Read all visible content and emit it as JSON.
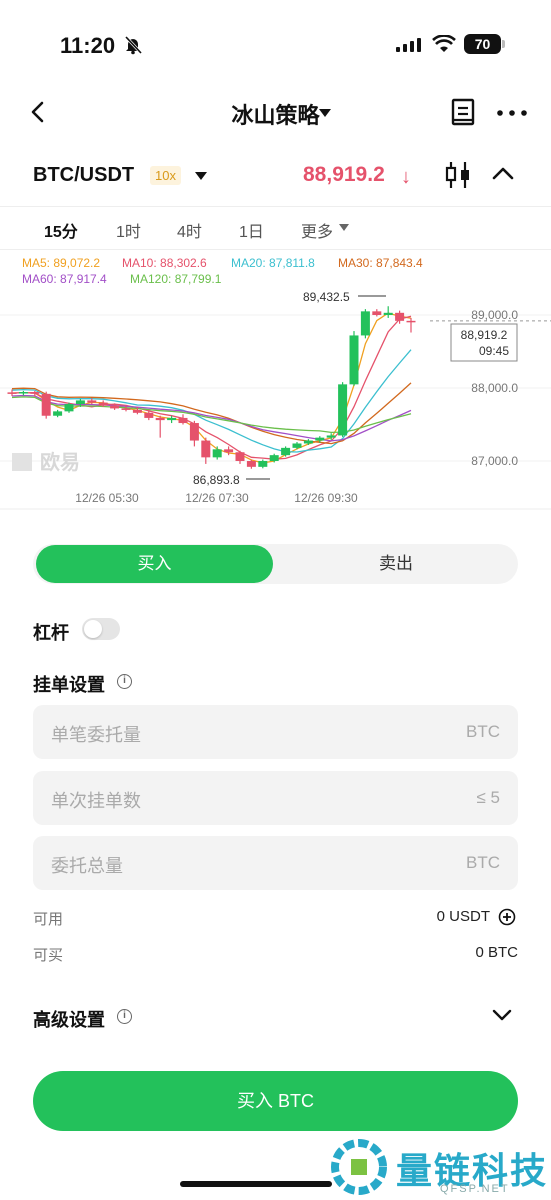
{
  "status": {
    "time": "11:20",
    "battery": "70"
  },
  "header": {
    "title": "冰山策略"
  },
  "market": {
    "pair": "BTC/USDT",
    "leverage": "10x",
    "price": "88,919.2",
    "price_arrow": "↓"
  },
  "timeframes": [
    "15分",
    "1时",
    "4时",
    "1日",
    "更多"
  ],
  "active_timeframe": 0,
  "ma_legend": {
    "ma5": "MA5: 89,072.2",
    "ma10": "MA10: 88,302.6",
    "ma20": "MA20: 87,811.8",
    "ma30": "MA30: 87,843.4",
    "ma60": "MA60: 87,917.4",
    "ma120": "MA120: 87,799.1"
  },
  "colors": {
    "up": "#23c15b",
    "down": "#e5526b",
    "ma5": "#f0a020",
    "ma10": "#e5526b",
    "ma20": "#3bbfcf",
    "ma30": "#d2691e",
    "ma60": "#a24fc7",
    "ma120": "#6abf4b"
  },
  "chart_data": {
    "type": "candlestick",
    "y_ticks": [
      "89,000.0",
      "88,000.0",
      "87,000.0"
    ],
    "x_ticks": [
      "12/26 05:30",
      "12/26 07:30",
      "12/26 09:30"
    ],
    "high_label": "89,432.5",
    "low_label": "86,893.8",
    "current_price_label": "88,919.2",
    "countdown": "09:45",
    "watermark": "欧易",
    "candles": [
      [
        87940,
        87980,
        87890,
        87930
      ],
      [
        87930,
        87960,
        87900,
        87945
      ],
      [
        87945,
        87960,
        87880,
        87920
      ],
      [
        87920,
        87950,
        87580,
        87620
      ],
      [
        87620,
        87700,
        87600,
        87680
      ],
      [
        87680,
        87800,
        87660,
        87780
      ],
      [
        87780,
        87850,
        87740,
        87830
      ],
      [
        87830,
        87860,
        87780,
        87800
      ],
      [
        87800,
        87830,
        87740,
        87760
      ],
      [
        87760,
        87790,
        87700,
        87720
      ],
      [
        87720,
        87760,
        87680,
        87700
      ],
      [
        87700,
        87740,
        87640,
        87660
      ],
      [
        87660,
        87700,
        87560,
        87590
      ],
      [
        87590,
        87620,
        87320,
        87560
      ],
      [
        87560,
        87620,
        87520,
        87590
      ],
      [
        87590,
        87640,
        87500,
        87520
      ],
      [
        87520,
        87550,
        87200,
        87280
      ],
      [
        87280,
        87320,
        86960,
        87050
      ],
      [
        87050,
        87200,
        87020,
        87160
      ],
      [
        87160,
        87200,
        87080,
        87120
      ],
      [
        87120,
        87140,
        86960,
        87000
      ],
      [
        87000,
        87020,
        86893.8,
        86920
      ],
      [
        86920,
        87020,
        86900,
        87000
      ],
      [
        87000,
        87100,
        86980,
        87080
      ],
      [
        87080,
        87200,
        87060,
        87180
      ],
      [
        87180,
        87260,
        87160,
        87240
      ],
      [
        87240,
        87300,
        87220,
        87280
      ],
      [
        87280,
        87340,
        87250,
        87320
      ],
      [
        87320,
        87380,
        87290,
        87350
      ],
      [
        87350,
        88080,
        87330,
        88050
      ],
      [
        88050,
        88780,
        88030,
        88720
      ],
      [
        88720,
        89080,
        88680,
        89050
      ],
      [
        89050,
        89080,
        88980,
        89000
      ],
      [
        89000,
        89120,
        88960,
        89030
      ],
      [
        89030,
        89060,
        88880,
        88920
      ],
      [
        88920,
        88960,
        88760,
        88919.2
      ]
    ]
  },
  "trade": {
    "buy_tab": "买入",
    "sell_tab": "卖出",
    "leverage_label": "杠杆",
    "order_settings_label": "挂单设置",
    "info_icon": "i",
    "fields": [
      {
        "placeholder": "单笔委托量",
        "unit": "BTC"
      },
      {
        "placeholder": "单次挂单数",
        "unit": "≤ 5"
      },
      {
        "placeholder": "委托总量",
        "unit": "BTC"
      }
    ],
    "available_label": "可用",
    "available_value": "0 USDT",
    "buyable_label": "可买",
    "buyable_value": "0 BTC",
    "advanced_label": "高级设置",
    "submit_label": "买入 BTC"
  },
  "watermark": {
    "text": "量链科技",
    "sub": "QFSP.NET"
  }
}
